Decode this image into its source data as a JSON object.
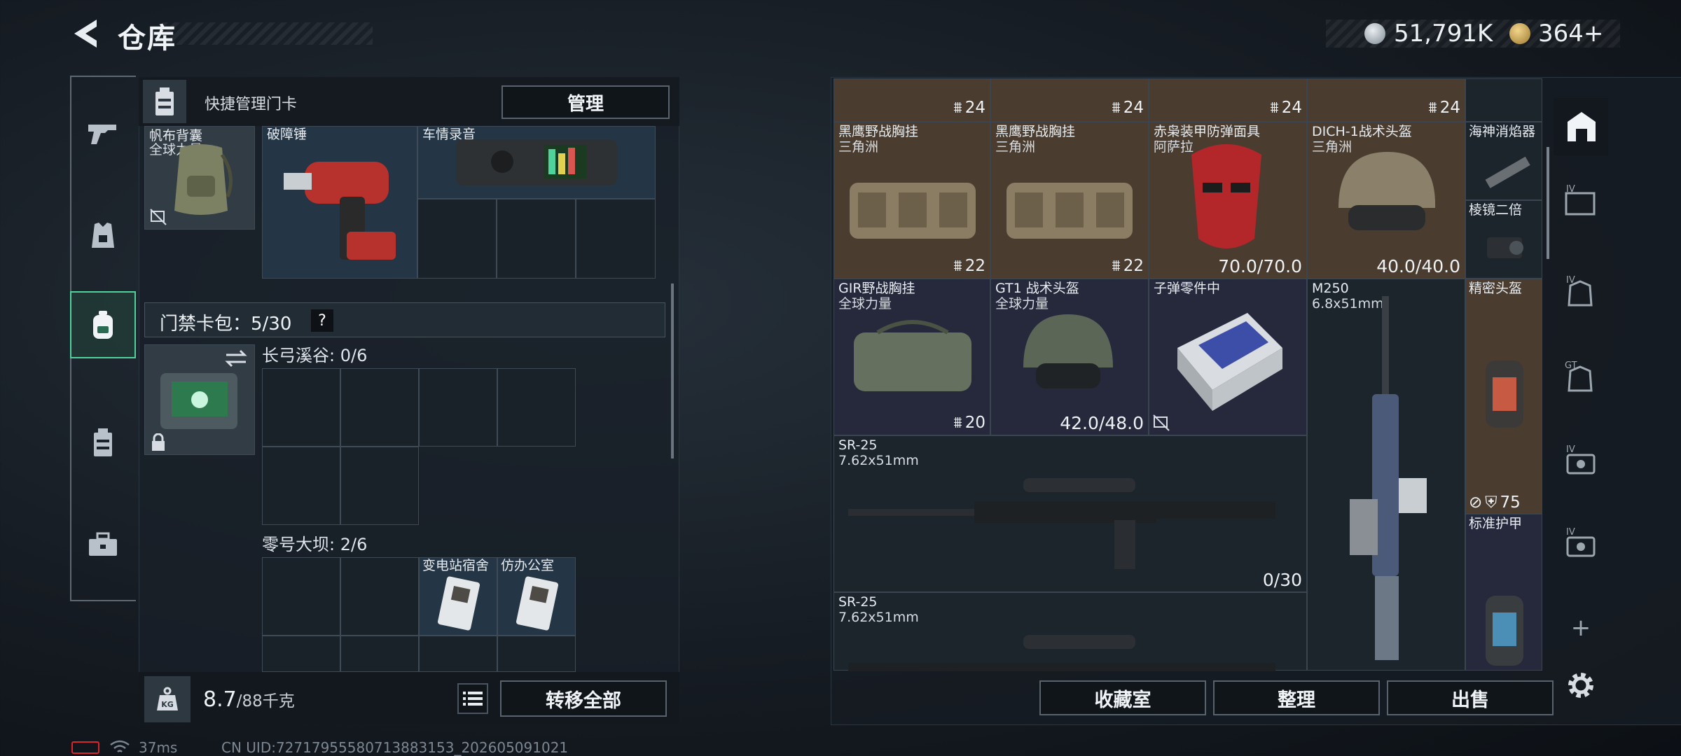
{
  "header": {
    "title": "仓库"
  },
  "currency": {
    "silver": "51,791K",
    "gold": "364",
    "gold_plus": "+"
  },
  "quick_manage": {
    "label": "快捷管理门卡",
    "manage_button": "管理"
  },
  "backpack_items": [
    {
      "name": "帆布背囊",
      "sub": "全球力量"
    },
    {
      "name": "破障锤",
      "sub": ""
    },
    {
      "name": "车情录音",
      "sub": ""
    }
  ],
  "keycards": {
    "label": "门禁卡包：5/30",
    "help": "?",
    "maps": [
      {
        "label": "长弓溪谷: 0/6"
      },
      {
        "label": "零号大坝: 2/6",
        "cards": [
          "变电站宿舍",
          "仿办公室"
        ]
      }
    ]
  },
  "weight": {
    "current": "8.7",
    "max": "/88千克"
  },
  "left_actions": {
    "transfer_all": "转移全部"
  },
  "grid": {
    "top_counts": [
      "24",
      "24",
      "24",
      "24"
    ],
    "items": [
      {
        "name": "黑鹰野战胸挂",
        "sub": "三角洲",
        "count": "22"
      },
      {
        "name": "黑鹰野战胸挂",
        "sub": "三角洲",
        "count": "22"
      },
      {
        "name": "赤枭装甲防弹面具",
        "sub": "阿萨拉",
        "durability": "70.0/70.0"
      },
      {
        "name": "DICH-1战术头盔",
        "sub": "三角洲",
        "durability": "40.0/40.0"
      },
      {
        "name": "海神消焰器",
        "sub": ""
      },
      {
        "name": "棱镜二倍",
        "sub": ""
      },
      {
        "name": "GIR野战胸挂",
        "sub": "全球力量",
        "count": "20"
      },
      {
        "name": "GT1 战术头盔",
        "sub": "全球力量",
        "durability": "42.0/48.0"
      },
      {
        "name": "子弹零件中",
        "sub": ""
      },
      {
        "name": "M250",
        "sub": "6.8x51mm"
      },
      {
        "name": "精密头盔",
        "sub": "",
        "armor": "75"
      },
      {
        "name": "SR-25",
        "sub": "7.62x51mm",
        "ammo": "0/30"
      },
      {
        "name": "标准护甲",
        "sub": ""
      },
      {
        "name": "SR-25",
        "sub": "7.62x51mm"
      }
    ]
  },
  "right_actions": {
    "collection": "收藏室",
    "organize": "整理",
    "sell": "出售"
  },
  "right_nav": [
    "IV",
    "IV",
    "GT",
    "IV",
    "IV",
    "+"
  ],
  "status": {
    "ping": "37ms",
    "uid": "CN UID:72717955580713883153_202605091021"
  },
  "colors": {
    "accent_green": "#4fd29b",
    "item_brown": "#4a3d30",
    "item_navy": "#26283c",
    "item_blue": "#243546"
  }
}
